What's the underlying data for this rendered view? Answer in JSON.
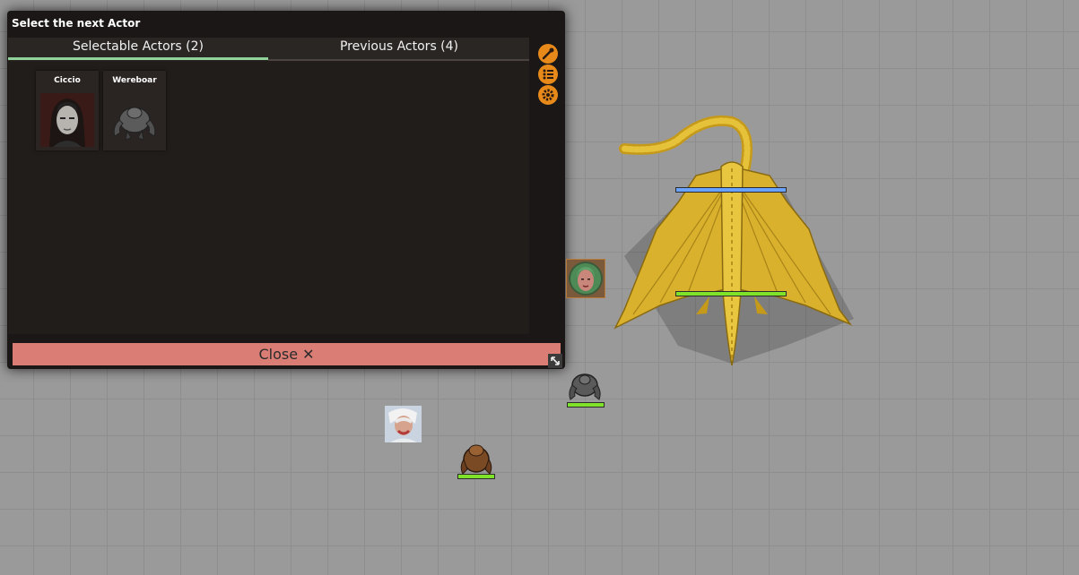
{
  "dialog": {
    "title": "Select the next Actor",
    "tabs": [
      {
        "label": "Selectable Actors (2)",
        "active": true
      },
      {
        "label": "Previous Actors (4)",
        "active": false
      }
    ],
    "actors": [
      {
        "name": "Ciccio",
        "portrait_icon": "ciccio-portrait"
      },
      {
        "name": "Wereboar",
        "portrait_icon": "wereboar-portrait"
      }
    ],
    "side_icons": [
      "eyedropper-icon",
      "list-icon",
      "gear-icon"
    ],
    "close_label": "Close ✕",
    "colors": {
      "accent_tab": "#8fd39b",
      "close_bar": "#d97d75",
      "side_icon": "#e88a1a"
    }
  },
  "canvas": {
    "tokens": [
      "dragon-token",
      "green-hair-woman-token",
      "wereboar-token",
      "white-haired-warrior-token",
      "brown-bear-token"
    ]
  }
}
